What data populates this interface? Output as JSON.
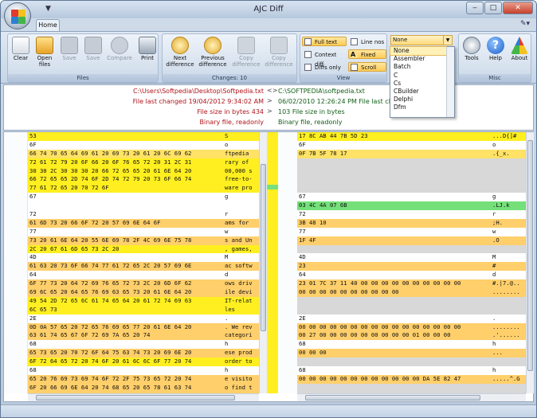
{
  "window": {
    "title": "AJC Diff",
    "quick_access": "▼"
  },
  "watermark": "SOFTPEDIA",
  "tabs": [
    {
      "label": "Home"
    }
  ],
  "ribbon": {
    "groups": [
      {
        "label": "Files"
      },
      {
        "label": "Changes: 10"
      },
      {
        "label": "View"
      },
      {
        "label": "Misc"
      }
    ],
    "buttons": {
      "clear": "Clear",
      "open_files": "Open files",
      "save": "Save",
      "save2": "Save",
      "compare": "Compare",
      "print": "Print",
      "next": "Next difference",
      "prev": "Previous difference",
      "copy1": "Copy difference",
      "copy2": "Copy difference",
      "tools": "Tools",
      "help": "Help",
      "about": "About"
    },
    "view": {
      "full_text": "Full text",
      "context_diff": "Context diff",
      "diffs_only": "Diffs only",
      "line_nos": "Line nos",
      "fixed": "Fixed",
      "scroll": "Scroll"
    },
    "language_selected": "None"
  },
  "language_options": [
    "None",
    "Assembler",
    "Batch",
    "C",
    "Cs",
    "CBuilder",
    "Delphi",
    "Dfm"
  ],
  "info": {
    "left": {
      "path": "C:\\Users\\Softpedia\\Desktop\\Softpedia.txt",
      "changed": "File last changed 19/04/2012 9:34:02 AM",
      "size": "File size in bytes 434",
      "type": "Binary file, readonly"
    },
    "right": {
      "path": "C:\\SOFTPEDIA\\softpedia.txt",
      "changed": "06/02/2010 12:26:24 PM File last changed",
      "size": "103 File size in bytes",
      "type": "Binary file, readonly"
    },
    "arrows": [
      "<>",
      ">",
      ">",
      ""
    ]
  },
  "left_rows": [
    {
      "h": "53",
      "t": "S",
      "c": "b1"
    },
    {
      "h": "6F",
      "t": "o",
      "c": "b0"
    },
    {
      "h": "66 74 70 65 64 69 61 20 69 73 20 61 20 6C 69 62",
      "t": "ftpedia",
      "c": "b2"
    },
    {
      "h": "72 61 72 79 20 6F 66 20 6F 76 65 72 20 31 2C 31",
      "t": "rary of",
      "c": "b1"
    },
    {
      "h": "30 30 2C 30 30 30 20 66 72 65 65 20 61 6E 64 20",
      "t": "00,000 s",
      "c": "b1"
    },
    {
      "h": "66 72 65 65 2D 74 6F 2D 74 72 79 20 73 6F 66 74",
      "t": "free-to-",
      "c": "b1"
    },
    {
      "h": "77 61 72 65 20 70 72 6F",
      "t": "ware pro",
      "c": "b1"
    },
    {
      "h": "67",
      "t": "g",
      "c": "b0"
    },
    {
      "h": "",
      "t": "",
      "c": "b0"
    },
    {
      "h": "72",
      "t": "r",
      "c": "b0"
    },
    {
      "h": "61 6D 73 20 66 6F 72 20 57 69 6E 64 6F",
      "t": "ams for",
      "c": "b3"
    },
    {
      "h": "77",
      "t": "w",
      "c": "b0"
    },
    {
      "h": "73 20 61 6E 64 20 55 6E 69 78 2F 4C 69 6E 75 78",
      "t": "s and Un",
      "c": "b3"
    },
    {
      "h": "2C 20 67 61 6D 65 73 2C 20",
      "t": ", games,",
      "c": "b1"
    },
    {
      "h": "4D",
      "t": "M",
      "c": "b0"
    },
    {
      "h": "61 63 20 73 6F 66 74 77 61 72 65 2C 20 57 69 6E",
      "t": "ac softw",
      "c": "b3"
    },
    {
      "h": "64",
      "t": "d",
      "c": "b0"
    },
    {
      "h": "6F 77 73 20 64 72 69 76 65 72 73 2C 20 6D 6F 62",
      "t": "ows driv",
      "c": "b3"
    },
    {
      "h": "69 6C 65 20 64 65 76 69 63 65 73 20 61 6E 64 20",
      "t": "ile devi",
      "c": "b3"
    },
    {
      "h": "49 54 2D 72 65 6C 61 74 65 64 20 61 72 74 69 63",
      "t": "IT-relat",
      "c": "b1"
    },
    {
      "h": "6C 65 73",
      "t": "les",
      "c": "b1"
    },
    {
      "h": "2E",
      "t": ".",
      "c": "b0"
    },
    {
      "h": "0D 0A 57 65 20 72 65 76 69 65 77 20 61 6E 64 20",
      "t": ". We rev",
      "c": "b3"
    },
    {
      "h": "63 61 74 65 67 6F 72 69 7A 65 20 74",
      "t": "categori",
      "c": "b3"
    },
    {
      "h": "68",
      "t": "h",
      "c": "b0"
    },
    {
      "h": "65 73 65 20 70 72 6F 64 75 63 74 73 20 69 6E 20",
      "t": "ese prod",
      "c": "b3"
    },
    {
      "h": "6F 72 64 65 72 20 74 6F 20 61 6C 6C 6F 77 20 74",
      "t": "order to",
      "c": "b1"
    },
    {
      "h": "68",
      "t": "h",
      "c": "b0"
    },
    {
      "h": "65 20 76 69 73 69 74 6F 72 2F 75 73 65 72 20 74",
      "t": "e visito",
      "c": "b3"
    },
    {
      "h": "6F 20 66 69 6E 64 20 74 68 65 20 65 78 61 63 74",
      "t": "o find t",
      "c": "b3"
    },
    {
      "h": "20 70 72 6F 64 75 63 74 20 74 68 65 79 20 61 6E",
      "t": " product",
      "c": "b3"
    },
    {
      "h": "64 20 74 68 65 69 72 20 73 79 73 74 65 6D 20 6E",
      "t": "d their",
      "c": "b3"
    }
  ],
  "right_rows": [
    {
      "h": "17 8C AB 44 7B 5D 23",
      "t": "...D{]#",
      "c": "b1"
    },
    {
      "h": "6F",
      "t": "o",
      "c": "b0"
    },
    {
      "h": "0F 7B 5F 78 17",
      "t": ".{_x.",
      "c": "b2"
    },
    {
      "h": "",
      "t": "",
      "c": "b4"
    },
    {
      "h": "",
      "t": "",
      "c": "b4"
    },
    {
      "h": "",
      "t": "",
      "c": "b4"
    },
    {
      "h": "",
      "t": "",
      "c": "b4"
    },
    {
      "h": "67",
      "t": "g",
      "c": "b0"
    },
    {
      "h": "03 4C 4A 07 6B",
      "t": ".LJ.k",
      "c": "b5"
    },
    {
      "h": "72",
      "t": "r",
      "c": "b0"
    },
    {
      "h": "3B 48 10",
      "t": ";H.",
      "c": "b3"
    },
    {
      "h": "77",
      "t": "w",
      "c": "b0"
    },
    {
      "h": "1F 4F",
      "t": ".O",
      "c": "b3"
    },
    {
      "h": "",
      "t": "",
      "c": "b4"
    },
    {
      "h": "4D",
      "t": "M",
      "c": "b0"
    },
    {
      "h": "23",
      "t": "#",
      "c": "b3"
    },
    {
      "h": "64",
      "t": "d",
      "c": "b0"
    },
    {
      "h": "23 01 7C 37 11 40 00 00 00 00 00 00 00 00 00 00",
      "t": "#.|7.@..",
      "c": "b3"
    },
    {
      "h": "00 00 00 00 00 00 00 00 00 00",
      "t": "........",
      "c": "b3"
    },
    {
      "h": "",
      "t": "",
      "c": "b4"
    },
    {
      "h": "",
      "t": "",
      "c": "b4"
    },
    {
      "h": "2E",
      "t": ".",
      "c": "b0"
    },
    {
      "h": "00 00 00 00 00 00 00 00 00 00 00 00 00 00 00 00",
      "t": "........",
      "c": "b3"
    },
    {
      "h": "00 27 00 00 00 00 00 00 00 00 00 01 00 00 00",
      "t": ".'......",
      "c": "b3"
    },
    {
      "h": "68",
      "t": "h",
      "c": "b0"
    },
    {
      "h": "00 00 00",
      "t": "...",
      "c": "b3"
    },
    {
      "h": "",
      "t": "",
      "c": "b4"
    },
    {
      "h": "68",
      "t": "h",
      "c": "b0"
    },
    {
      "h": "00 00 00 00 00 00 00 00 00 00 00 00 DA 5E 82 47",
      "t": ".....^.G",
      "c": "b3"
    },
    {
      "h": "",
      "t": "",
      "c": "b4"
    },
    {
      "h": "",
      "t": "",
      "c": "b4"
    },
    {
      "h": "",
      "t": "",
      "c": "b4"
    }
  ],
  "colors": {
    "changed": "#ffef20",
    "modified": "#ffcf6b",
    "missing": "#d8d8d8",
    "added": "#75e07a",
    "left_info": "#b0141a",
    "right_info": "#14601a"
  }
}
